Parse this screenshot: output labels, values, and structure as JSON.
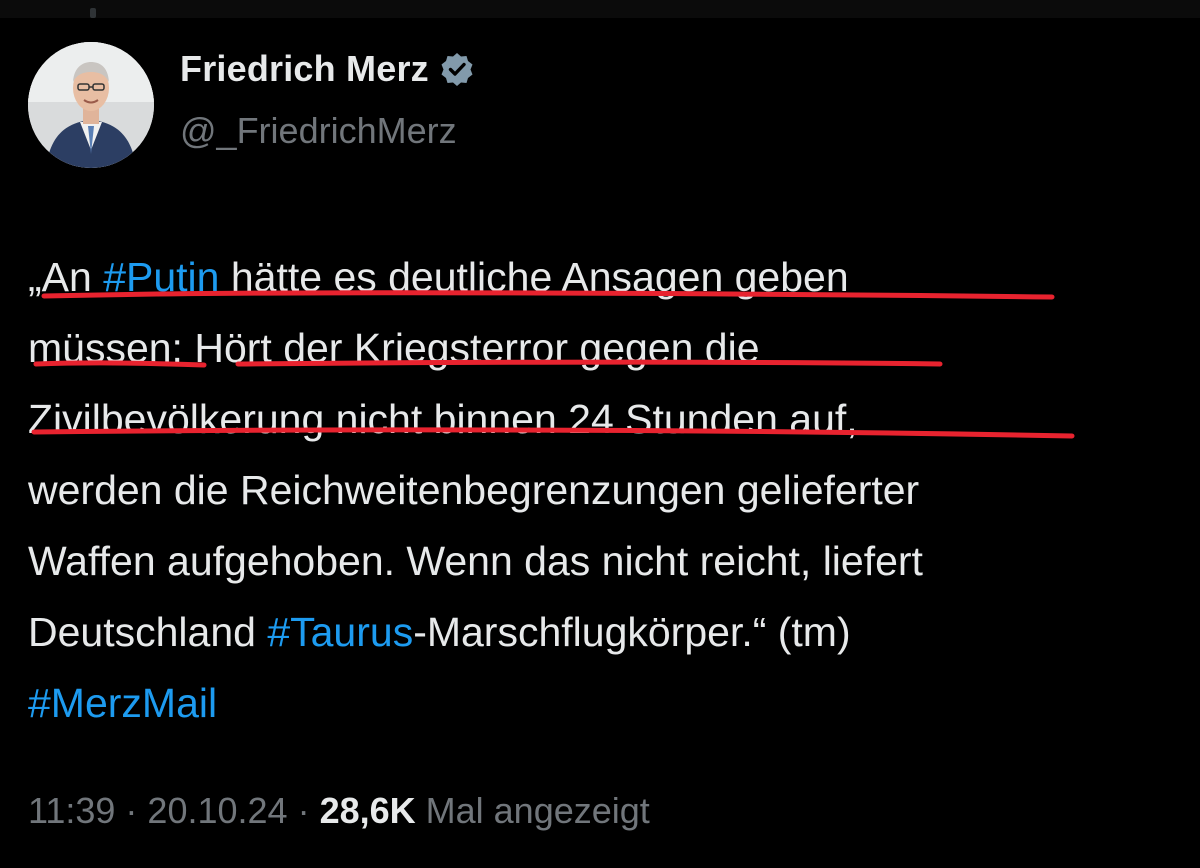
{
  "author": {
    "name": "Friedrich Merz",
    "handle": "@_FriedrichMerz",
    "verified_icon": "verified-badge-icon"
  },
  "tweet": {
    "l1_a": "„An ",
    "l1_tag": "#Putin",
    "l1_b": " hätte es deutliche Ansagen geben",
    "l2": "müssen: Hört der Kriegsterror gegen die",
    "l3": "Zivilbevölkerung nicht binnen 24 Stunden auf,",
    "l4": "werden die Reichweitenbegrenzungen gelieferter",
    "l5": "Waffen aufgehoben. Wenn das nicht reicht, liefert",
    "l6_a": "Deutschland ",
    "l6_tag": "#Taurus",
    "l6_b": "-Marschflugkörper.“ (tm)",
    "l7_tag": "#MerzMail"
  },
  "meta": {
    "time": "11:39",
    "sep1": " · ",
    "date": "20.10.24",
    "sep2": " · ",
    "views_count": "28,6K",
    "views_label": " Mal angezeigt"
  },
  "colors": {
    "background": "#000000",
    "text": "#e7e9ea",
    "muted": "#71767b",
    "link": "#1d9bf0",
    "underline": "#e8232f"
  }
}
